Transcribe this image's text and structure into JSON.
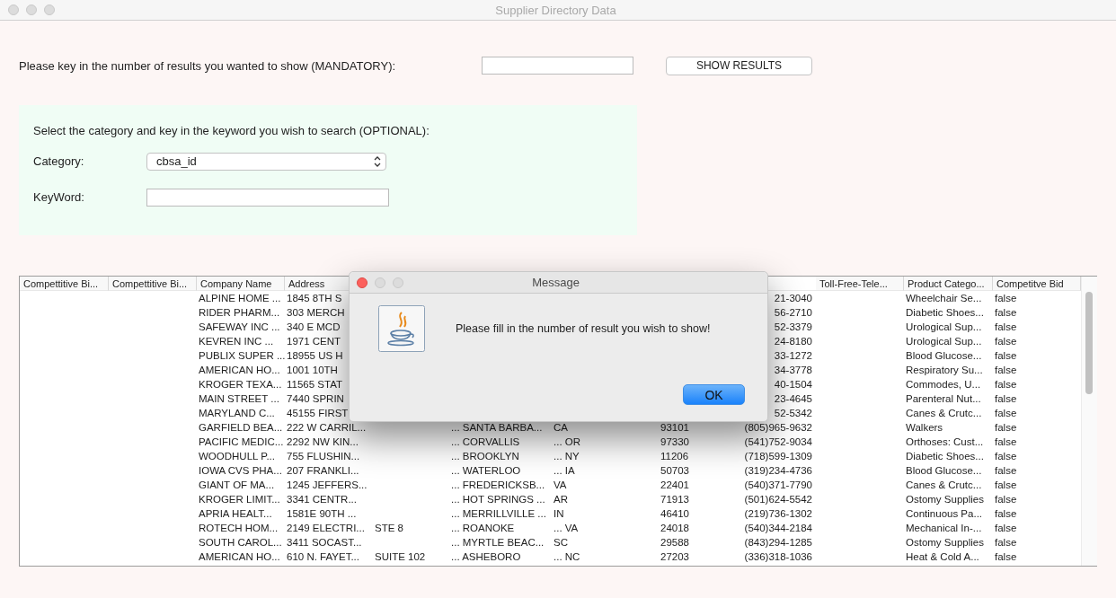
{
  "window": {
    "title": "Supplier Directory Data"
  },
  "results_prompt": {
    "label": "Please key in the number of results you wanted to show (MANDATORY):",
    "button": "SHOW RESULTS"
  },
  "search_panel": {
    "heading": "Select the category and key in the keyword you wish to search (OPTIONAL):",
    "category_label": "Category:",
    "category_value": "cbsa_id",
    "keyword_label": "KeyWord:"
  },
  "table": {
    "columns": [
      {
        "label": "Compettitive Bi..."
      },
      {
        "label": "Compettitive Bi..."
      },
      {
        "label": "Company Name"
      },
      {
        "label": "Address"
      },
      {
        "label": "Toll-Free-Tele..."
      },
      {
        "label": "Product Catego..."
      },
      {
        "label": "Competitve Bid"
      }
    ],
    "rows": [
      {
        "company_name": "ALPINE HOME ...",
        "address": "1845 8TH S",
        "column_9": "21-3040",
        "product_category": "Wheelchair Se...",
        "competitive_bid": "false"
      },
      {
        "company_name": "RIDER PHARM...",
        "address": "303 MERCH",
        "column_9": "56-2710",
        "product_category": "Diabetic Shoes...",
        "competitive_bid": "false"
      },
      {
        "company_name": "SAFEWAY INC  ...",
        "address": "340 E MCD",
        "column_9": "52-3379",
        "product_category": "Urological Sup...",
        "competitive_bid": "false"
      },
      {
        "company_name": "KEVREN INC   ...",
        "address": "1971 CENT",
        "column_9": "24-8180",
        "product_category": "Urological Sup...",
        "competitive_bid": "false"
      },
      {
        "company_name": "PUBLIX SUPER ...",
        "address": "18955 US H",
        "column_9": "33-1272",
        "product_category": "Blood Glucose...",
        "competitive_bid": "false"
      },
      {
        "company_name": "AMERICAN HO...",
        "address": "1001 10TH",
        "column_9": "34-3778",
        "product_category": "Respiratory Su...",
        "competitive_bid": "false"
      },
      {
        "company_name": "KROGER TEXA...",
        "address": "11565 STAT",
        "column_9": "40-1504",
        "product_category": "Commodes, U...",
        "competitive_bid": "false"
      },
      {
        "company_name": "MAIN STREET ...",
        "address": "7440 SPRIN",
        "column_9": "23-4645",
        "product_category": "Parenteral Nut...",
        "competitive_bid": "false"
      },
      {
        "company_name": "MARYLAND C...",
        "address": "45155 FIRST",
        "column_9": "52-5342",
        "product_category": "Canes & Crutc...",
        "competitive_bid": "false"
      },
      {
        "company_name": "GARFIELD BEA...",
        "address": "222 W CARRIL...",
        "column_6": "... SANTA BARBA...",
        "column_7": "CA",
        "column_8": "93101",
        "column_9": "(805)965-9632",
        "product_category": "Walkers",
        "competitive_bid": "false"
      },
      {
        "company_name": "PACIFIC MEDIC...",
        "address": "2292 NW KIN...",
        "column_6": "... CORVALLIS",
        "column_7": "... OR",
        "column_8": "97330",
        "column_9": "(541)752-9034",
        "product_category": "Orthoses: Cust...",
        "competitive_bid": "false"
      },
      {
        "company_name": "WOODHULL P...",
        "address": "755 FLUSHIN...",
        "column_6": "... BROOKLYN",
        "column_7": "... NY",
        "column_8": "11206",
        "column_9": "(718)599-1309",
        "product_category": "Diabetic Shoes...",
        "competitive_bid": "false"
      },
      {
        "company_name": "IOWA CVS PHA...",
        "address": "207 FRANKLI...",
        "column_6": "... WATERLOO",
        "column_7": "... IA",
        "column_8": "50703",
        "column_9": "(319)234-4736",
        "product_category": "Blood Glucose...",
        "competitive_bid": "false"
      },
      {
        "company_name": "GIANT OF MA...",
        "address": "1245 JEFFERS...",
        "column_6": "... FREDERICKSB...",
        "column_7": "VA",
        "column_8": "22401",
        "column_9": "(540)371-7790",
        "product_category": "Canes & Crutc...",
        "competitive_bid": "false"
      },
      {
        "company_name": "KROGER LIMIT...",
        "address": "3341 CENTR...",
        "column_6": "... HOT SPRINGS ...",
        "column_7": "AR",
        "column_8": "71913",
        "column_9": "(501)624-5542",
        "product_category": "Ostomy Supplies",
        "competitive_bid": "false"
      },
      {
        "company_name": "APRIA HEALT...",
        "address": "1581E 90TH ...",
        "column_6": "... MERRILLVILLE ...",
        "column_7": "IN",
        "column_8": "46410",
        "column_9": "(219)736-1302",
        "product_category": "Continuous Pa...",
        "competitive_bid": "false"
      },
      {
        "company_name": "ROTECH HOM...",
        "address": "2149 ELECTRI...",
        "column_5": "STE 8",
        "column_6": "... ROANOKE",
        "column_7": "... VA",
        "column_8": "24018",
        "column_9": "(540)344-2184",
        "product_category": "Mechanical In-...",
        "competitive_bid": "false"
      },
      {
        "company_name": "SOUTH CAROL...",
        "address": "3411 SOCAST...",
        "column_6": "... MYRTLE BEAC...",
        "column_7": "SC",
        "column_8": "29588",
        "column_9": "(843)294-1285",
        "product_category": "Ostomy Supplies",
        "competitive_bid": "false"
      },
      {
        "company_name": "AMERICAN HO...",
        "address": "610 N. FAYET...",
        "column_5": "SUITE 102",
        "column_6": "... ASHEBORO",
        "column_7": "... NC",
        "column_8": "27203",
        "column_9": "(336)318-1036",
        "product_category": "Heat & Cold A...",
        "competitive_bid": "false"
      }
    ]
  },
  "dialog": {
    "title": "Message",
    "message": "Please fill in the number of result you wish to show!",
    "button": "OK"
  }
}
